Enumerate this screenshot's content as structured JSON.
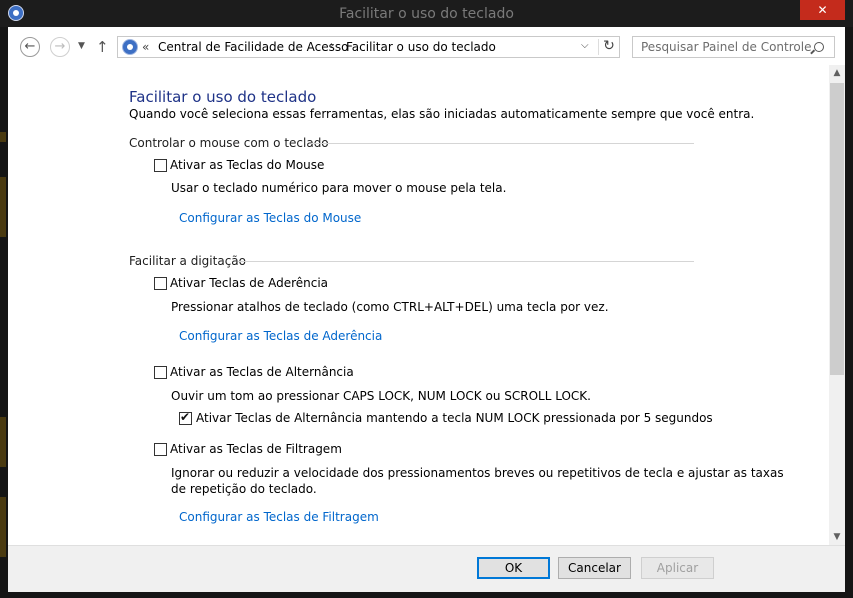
{
  "window": {
    "title": "Facilitar o uso do teclado",
    "close_glyph": "✕"
  },
  "nav": {
    "back_glyph": "←",
    "forward_glyph": "→",
    "recent_glyph": "▼",
    "up_glyph": "↑",
    "address_chevron": "«",
    "breadcrumb": [
      "Central de Facilidade de Acesso",
      "Facilitar o uso do teclado"
    ],
    "crumb_separator": "›",
    "dropdown_glyph": "⌵",
    "refresh_glyph": "↻",
    "search_placeholder": "Pesquisar Painel de Controle"
  },
  "content": {
    "title": "Facilitar o uso do teclado",
    "subtitle": "Quando você seleciona essas ferramentas, elas são iniciadas automaticamente sempre que você entra.",
    "section_mouse": {
      "heading": "Controlar o mouse com o teclado",
      "mouse_keys": {
        "label": "Ativar as Teclas do Mouse",
        "checked": false,
        "description": "Usar o teclado numérico para mover o mouse pela tela.",
        "link": "Configurar as Teclas do Mouse"
      }
    },
    "section_typing": {
      "heading": "Facilitar a digitação",
      "sticky_keys": {
        "label": "Ativar Teclas de Aderência",
        "checked": false,
        "description": "Pressionar atalhos de teclado (como CTRL+ALT+DEL) uma tecla por vez.",
        "link": "Configurar as Teclas de Aderência"
      },
      "toggle_keys": {
        "label": "Ativar as Teclas de Alternância",
        "checked": false,
        "description": "Ouvir um tom ao pressionar CAPS LOCK, NUM LOCK ou SCROLL LOCK.",
        "sub_option_label": "Ativar Teclas de Alternância mantendo a tecla NUM LOCK pressionada por 5 segundos",
        "sub_option_checked": true
      },
      "filter_keys": {
        "label": "Ativar as Teclas de Filtragem",
        "checked": false,
        "description_line1": "Ignorar ou reduzir a velocidade dos pressionamentos breves ou repetitivos de tecla e ajustar as taxas",
        "description_line2": "de repetição do teclado.",
        "link": "Configurar as Teclas de Filtragem"
      }
    }
  },
  "scrollbar": {
    "up_glyph": "▲",
    "down_glyph": "▼"
  },
  "buttons": {
    "ok": "OK",
    "cancel": "Cancelar",
    "apply": "Aplicar"
  }
}
